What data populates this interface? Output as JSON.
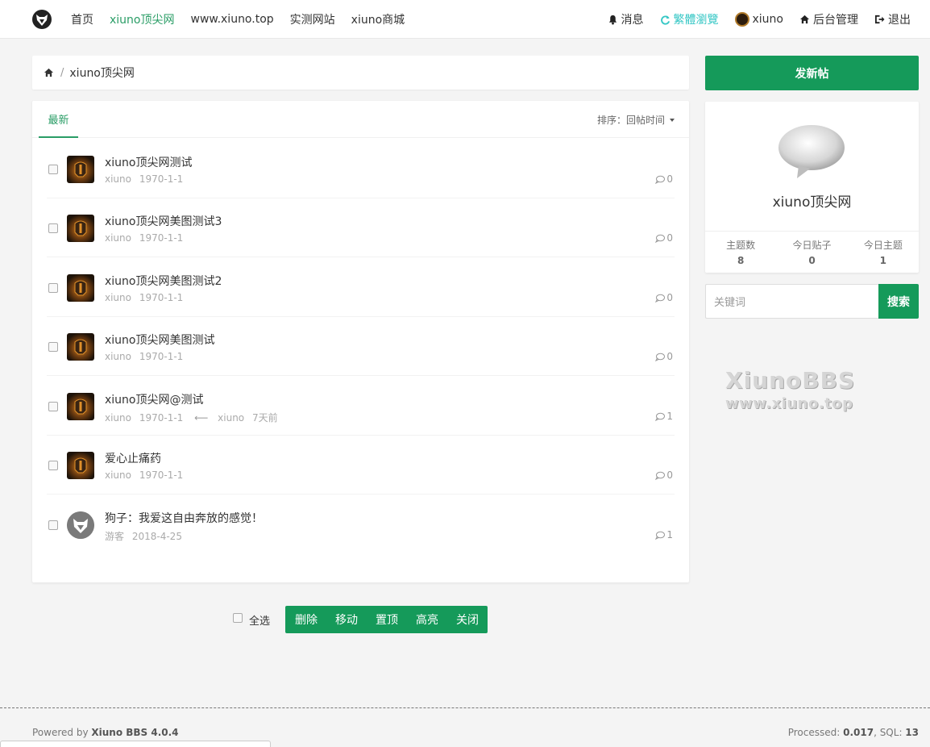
{
  "nav": {
    "links": [
      "首页",
      "xiuno顶尖网",
      "www.xiuno.top",
      "实测网站",
      "xiuno商城"
    ],
    "messages": "消息",
    "traditional": "繁體瀏覽",
    "user": "xiuno",
    "admin": "后台管理",
    "logout": "退出"
  },
  "breadcrumb": {
    "current": "xiuno顶尖网"
  },
  "tabs": {
    "latest": "最新",
    "sort_prefix": "排序：",
    "sort_value": "回帖时间"
  },
  "threads": [
    {
      "title": "xiuno顶尖网测试",
      "author": "xiuno",
      "date": "1970-1-1",
      "replies": "0",
      "avatar": "helmet"
    },
    {
      "title": "xiuno顶尖网美图测试3",
      "author": "xiuno",
      "date": "1970-1-1",
      "replies": "0",
      "avatar": "helmet"
    },
    {
      "title": "xiuno顶尖网美图测试2",
      "author": "xiuno",
      "date": "1970-1-1",
      "replies": "0",
      "avatar": "helmet"
    },
    {
      "title": "xiuno顶尖网美图测试",
      "author": "xiuno",
      "date": "1970-1-1",
      "replies": "0",
      "avatar": "helmet"
    },
    {
      "title": "xiuno顶尖网@测试",
      "author": "xiuno",
      "date": "1970-1-1",
      "last_reply_user": "xiuno",
      "last_reply_time": "7天前",
      "replies": "1",
      "avatar": "helmet"
    },
    {
      "title": "爱心止痛药",
      "author": "xiuno",
      "date": "1970-1-1",
      "replies": "0",
      "avatar": "helmet"
    },
    {
      "title": "狗子：我爱这自由奔放的感觉！",
      "author": "游客",
      "date": "2018-4-25",
      "replies": "1",
      "avatar": "logo"
    }
  ],
  "moderation": {
    "select_all": "全选",
    "actions": [
      "删除",
      "移动",
      "置顶",
      "高亮",
      "关闭"
    ]
  },
  "sidebar": {
    "new_thread": "发新帖",
    "forum_name": "xiuno顶尖网",
    "stats": [
      {
        "label": "主题数",
        "value": "8"
      },
      {
        "label": "今日贴子",
        "value": "0"
      },
      {
        "label": "今日主题",
        "value": "1"
      }
    ],
    "search_placeholder": "关键词",
    "search_button": "搜索",
    "watermark_title": "XiunoBBS",
    "watermark_url": "www.xiuno.top"
  },
  "footer": {
    "powered_prefix": "Powered by ",
    "powered_name": "Xiuno BBS 4.0.4",
    "processed_label": "Processed: ",
    "processed_value": "0.017",
    "sql_label": ", SQL: ",
    "sql_value": "13"
  },
  "colors": {
    "brand_green": "#159a5a",
    "tab_green": "#2a9d66",
    "cyan": "#35c7c5"
  }
}
